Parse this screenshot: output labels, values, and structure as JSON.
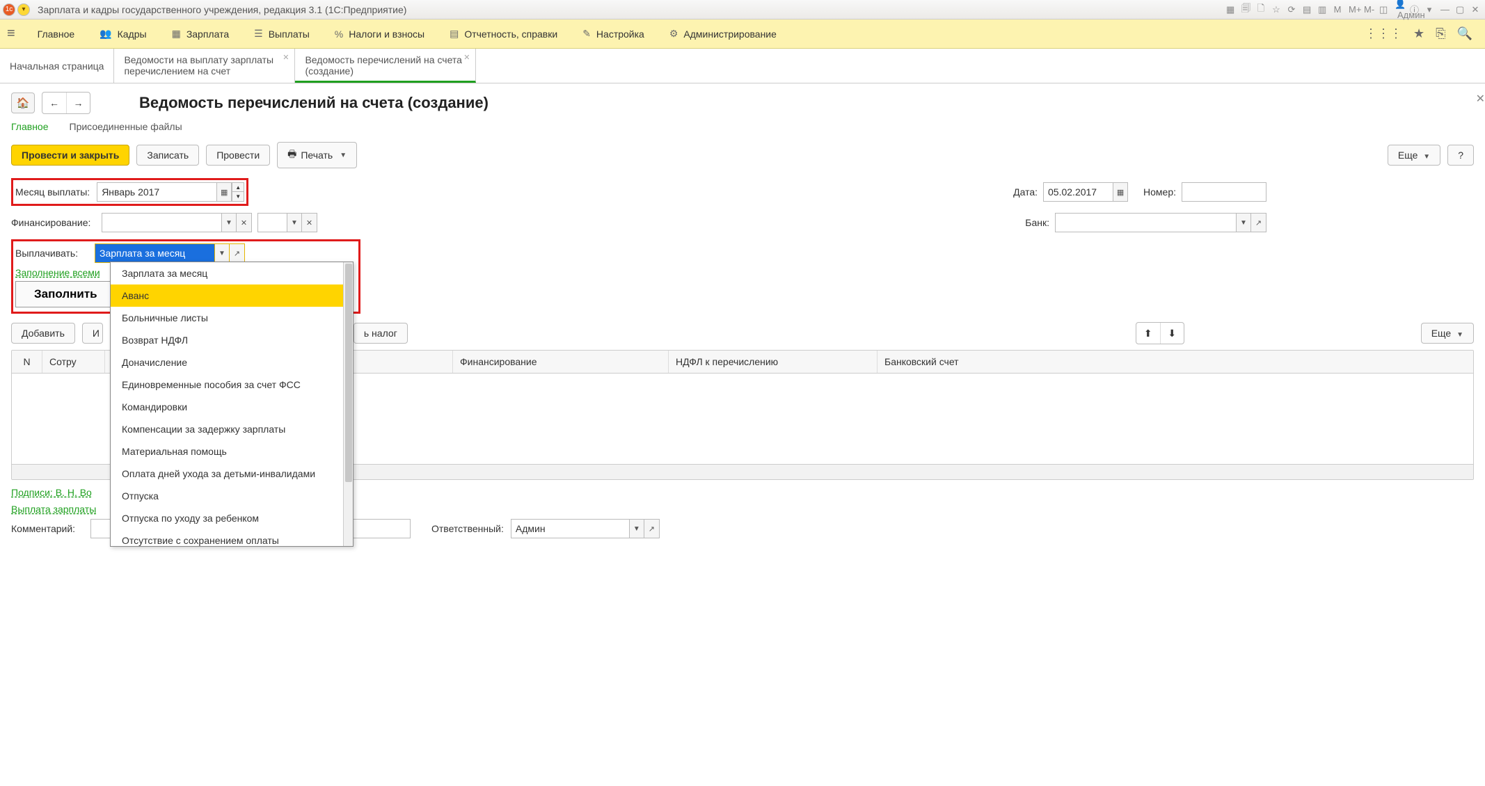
{
  "titlebar": {
    "title": "Зарплата и кадры государственного учреждения, редакция 3.1  (1С:Предприятие)",
    "user": "Админ",
    "sys": {
      "m": "M",
      "mplus": "M+",
      "mminus": "M-"
    }
  },
  "menu": {
    "items": [
      "Главное",
      "Кадры",
      "Зарплата",
      "Выплаты",
      "Налоги и взносы",
      "Отчетность, справки",
      "Настройка",
      "Администрирование"
    ]
  },
  "tabs": {
    "t0": "Начальная страница",
    "t1": "Ведомости на выплату зарплаты перечислением на счет",
    "t2": "Ведомость перечислений на счета (создание)"
  },
  "page": {
    "title": "Ведомость перечислений на счета (создание)",
    "subnav": {
      "main": "Главное",
      "files": "Присоединенные файлы"
    },
    "cmds": {
      "post_close": "Провести и закрыть",
      "save": "Записать",
      "post": "Провести",
      "print": "Печать",
      "more": "Еще",
      "help": "?"
    },
    "fields": {
      "month_label": "Месяц выплаты:",
      "month_val": "Январь 2017",
      "date_label": "Дата:",
      "date_val": "05.02.2017",
      "num_label": "Номер:",
      "fin_label": "Финансирование:",
      "bank_label": "Банк:",
      "pay_label": "Выплачивать:",
      "pay_val": "Зарплата за месяц",
      "fill_all": "Заполнение всеми",
      "fill": "Заполнить",
      "add": "Добавить",
      "tax": "ь налог",
      "sign": "Подписи: В. Н. Во",
      "payout": "Выплата зарплаты",
      "comment": "Комментарий:",
      "resp_label": "Ответственный:",
      "resp_val": "Админ"
    },
    "dropdown": {
      "options": [
        "Зарплата за месяц",
        "Аванс",
        "Больничные листы",
        "Возврат НДФЛ",
        "Доначисление",
        "Единовременные пособия за счет ФСС",
        "Командировки",
        "Компенсации за задержку зарплаты",
        "Материальная помощь",
        "Оплата дней ухода за детьми-инвалидами",
        "Отпуска",
        "Отпуска по уходу за ребенком",
        "Отсутствие с сохранением оплаты"
      ],
      "highlight_index": 1
    },
    "table": {
      "cols": {
        "n": "N",
        "emp": "Сотру",
        "fin": "Финансирование",
        "tax": "НДФЛ к перечислению",
        "bank": "Банковский счет"
      }
    }
  }
}
